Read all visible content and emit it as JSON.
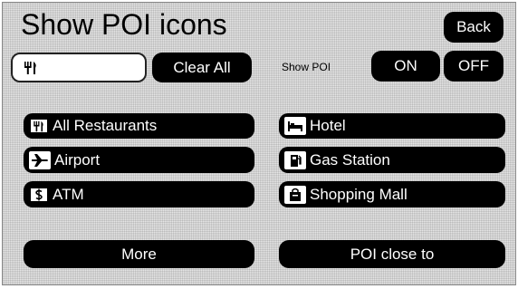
{
  "header": {
    "title": "Show POI icons",
    "back_label": "Back"
  },
  "search": {
    "selected_icon": "fork-knife-icon",
    "clear_label": "Clear All"
  },
  "show_poi": {
    "label": "Show POI",
    "on_label": "ON",
    "off_label": "OFF"
  },
  "poi_items": [
    {
      "label": "All Restaurants",
      "icon": "fork-knife-icon"
    },
    {
      "label": "Hotel",
      "icon": "bed-icon"
    },
    {
      "label": "Airport",
      "icon": "airplane-icon"
    },
    {
      "label": "Gas Station",
      "icon": "gas-pump-icon"
    },
    {
      "label": "ATM",
      "icon": "dollar-icon"
    },
    {
      "label": "Shopping Mall",
      "icon": "shopping-bag-icon"
    }
  ],
  "footer": {
    "more_label": "More",
    "poi_close_label": "POI close to"
  }
}
